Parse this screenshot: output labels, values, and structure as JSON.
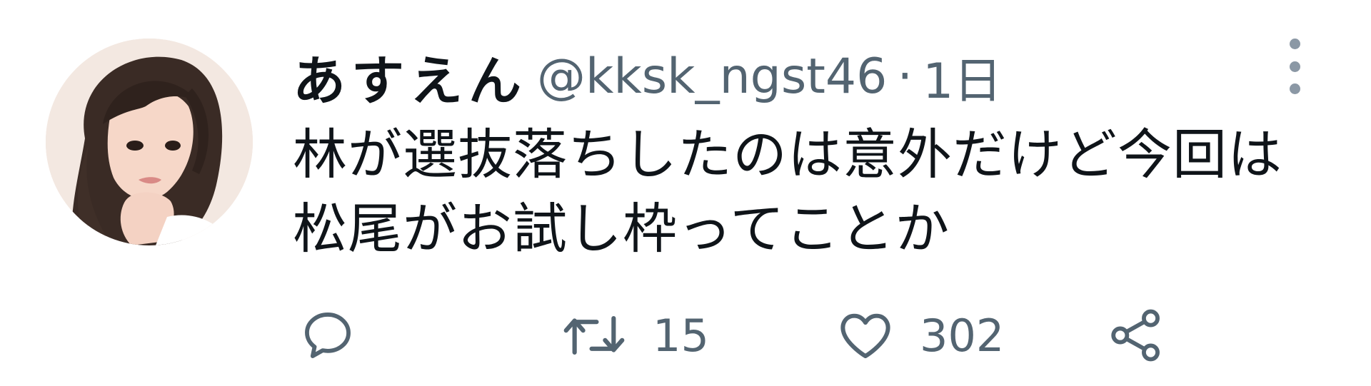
{
  "tweet": {
    "display_name": "あすえん",
    "handle": "@kksk_ngst46",
    "separator": "·",
    "time": "1日",
    "text_lines": [
      "林が選抜落ちしたのは意外だけど今回は",
      "松尾がお試し枠ってことか"
    ]
  },
  "actions": {
    "reply": {
      "icon": "reply-icon"
    },
    "retweet": {
      "icon": "retweet-icon",
      "count": "15"
    },
    "like": {
      "icon": "heart-icon",
      "count": "302"
    },
    "share": {
      "icon": "share-icon"
    }
  },
  "colors": {
    "text": "#0f1419",
    "secondary": "#536471",
    "icon": "#536471",
    "more_dots": "#8b98a5"
  }
}
